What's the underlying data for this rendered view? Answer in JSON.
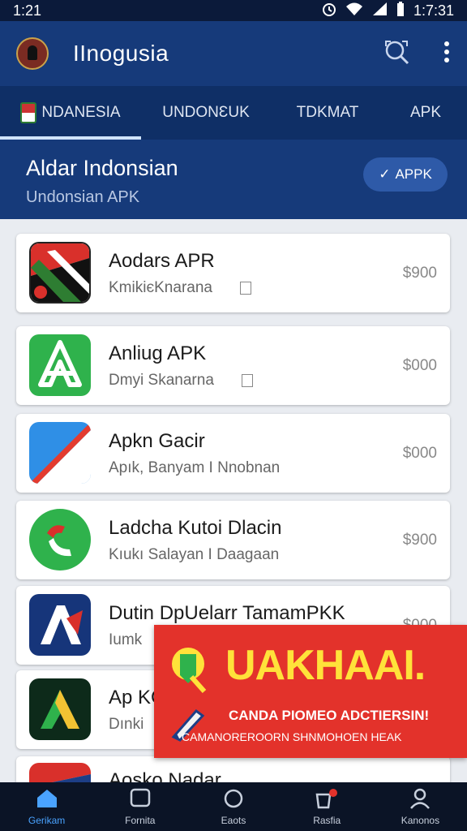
{
  "status_bar": {
    "time_left": "1:21",
    "time_right": "1:7:31"
  },
  "app_bar": {
    "title": "IInogusia",
    "icons": [
      "search-icon",
      "more-vert-icon"
    ]
  },
  "tabs": [
    {
      "label": "NDANESIA",
      "active": true
    },
    {
      "label": "UNDONƐUK",
      "active": false
    },
    {
      "label": "TDKMAT",
      "active": false
    },
    {
      "label": "APK",
      "active": false
    }
  ],
  "hero": {
    "title": "Aldar Indonsian",
    "subtitle": "Undonsian APK",
    "button_label": "APPK"
  },
  "apps": [
    {
      "name": "Aodars APR",
      "subtitle": "KmikiєKnarana",
      "price": "$900"
    },
    {
      "name": "Anliug APK",
      "subtitle": "Dmyi Skanarna",
      "price": "$000"
    },
    {
      "name": "Apkn Gacir",
      "subtitle": "Apık, Banyam I Nnobnan",
      "price": "$000"
    },
    {
      "name": "Ladcha Kutoi Dlacin",
      "subtitle": "Kıukı Salayan I Daagaan",
      "price": "$900"
    },
    {
      "name": "Dutin DpUelarr TamamPKK",
      "subtitle": "Iumk",
      "price": "$000"
    },
    {
      "name": "Ap KC",
      "subtitle": "Dınki",
      "price": ""
    },
    {
      "name": "Aosko Nadar",
      "subtitle": "",
      "price": ""
    }
  ],
  "promo": {
    "title": "UAKHAAI.",
    "line1": "CANDA PIOMEO ADCTIERSIN!",
    "line2": "CAMANOREROORN  SHNMOHOEN HEAK"
  },
  "bottom_nav": [
    {
      "label": "Gerikam",
      "icon": "home-icon",
      "active": true
    },
    {
      "label": "Fornita",
      "icon": "square-icon",
      "active": false
    },
    {
      "label": "Eaots",
      "icon": "circle-icon",
      "active": false
    },
    {
      "label": "Rasfia",
      "icon": "bag-icon",
      "active": false
    },
    {
      "label": "Kanonos",
      "icon": "person-icon",
      "active": false
    }
  ],
  "colors": {
    "appbar": "#163a7a",
    "tabs": "#0f2f66",
    "promo": "#e3322b",
    "promo_text": "#ffe23a",
    "nav_active": "#4aa3ff"
  }
}
